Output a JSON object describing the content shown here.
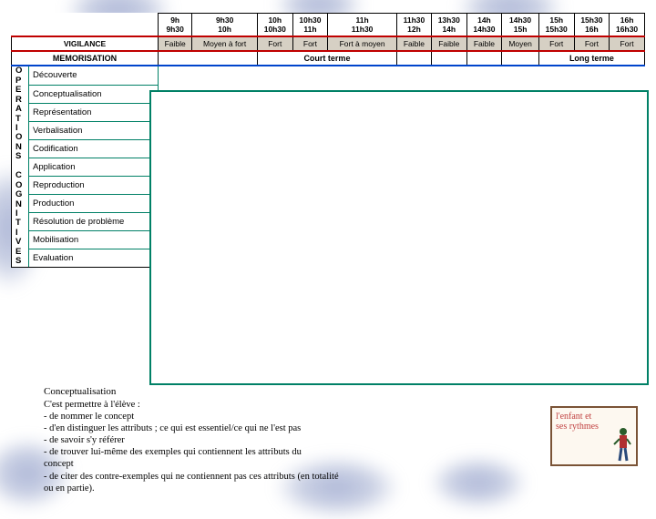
{
  "smudges": true,
  "time_header": [
    {
      "t1": "9h",
      "t2": "9h30"
    },
    {
      "t1": "9h30",
      "t2": "10h"
    },
    {
      "t1": "10h",
      "t2": "10h30"
    },
    {
      "t1": "10h30",
      "t2": "11h"
    },
    {
      "t1": "11h",
      "t2": "11h30"
    },
    {
      "t1": "11h30",
      "t2": "12h"
    },
    {
      "t1": "13h30",
      "t2": "14h"
    },
    {
      "t1": "14h",
      "t2": "14h30"
    },
    {
      "t1": "14h30",
      "t2": "15h"
    },
    {
      "t1": "15h",
      "t2": "15h30"
    },
    {
      "t1": "15h30",
      "t2": "16h"
    },
    {
      "t1": "16h",
      "t2": "16h30"
    }
  ],
  "vigilance": {
    "label": "VIGILANCE",
    "cells": [
      "Faible",
      "Moyen à fort",
      "Fort",
      "Fort",
      "Fort à moyen",
      "Faible",
      "Faible",
      "Faible",
      "Moyen",
      "Fort",
      "Fort",
      "Fort"
    ]
  },
  "memorisation": {
    "label": "MEMORISATION",
    "court": "Court terme",
    "long": "Long terme"
  },
  "vert_label": "OPERATIONS COGNITIVES",
  "operations": [
    "Découverte",
    "Conceptualisation",
    "Représentation",
    "Verbalisation",
    "Codification",
    "Application",
    "Reproduction",
    "Production",
    "Résolution de problème",
    "Mobilisation",
    "Evaluation"
  ],
  "note": {
    "title": "Conceptualisation",
    "lines": [
      "C'est permettre à l'élève :",
      "-        de nommer le concept",
      "-        d'en distinguer les attributs ; ce qui est essentiel/ce qui ne l'est pas",
      "-   de savoir s'y référer",
      "-        de trouver lui-même des exemples qui contiennent les attributs du",
      "concept",
      "-   de citer des contre-exemples qui ne contiennent pas ces attributs (en totalité",
      "ou en partie)."
    ]
  },
  "logo": {
    "line1": "l'enfant et",
    "line2": "ses rythmes"
  }
}
